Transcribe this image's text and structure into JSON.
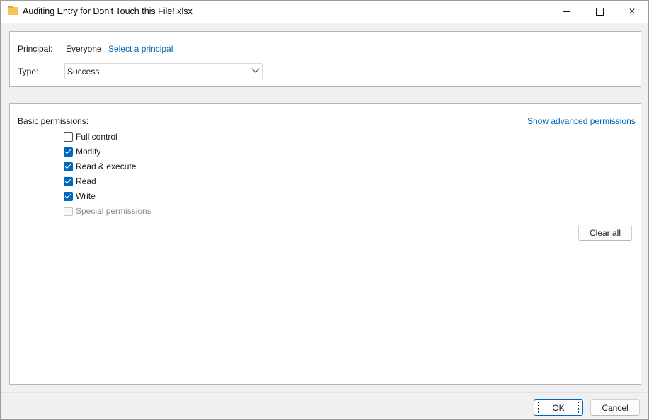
{
  "window": {
    "title": "Auditing Entry for Don't Touch this File!.xlsx",
    "title_icon": "folder-icon",
    "controls": {
      "minimize": "minimize-icon",
      "maximize": "maximize-icon",
      "close": "×"
    }
  },
  "principal": {
    "label": "Principal:",
    "value": "Everyone",
    "link": "Select a principal"
  },
  "type": {
    "label": "Type:",
    "selected": "Success"
  },
  "permissions": {
    "label": "Basic permissions:",
    "advanced_link": "Show advanced permissions",
    "items": [
      {
        "label": "Full control",
        "checked": false,
        "disabled": false
      },
      {
        "label": "Modify",
        "checked": true,
        "disabled": false
      },
      {
        "label": "Read & execute",
        "checked": true,
        "disabled": false
      },
      {
        "label": "Read",
        "checked": true,
        "disabled": false
      },
      {
        "label": "Write",
        "checked": true,
        "disabled": false
      },
      {
        "label": "Special permissions",
        "checked": false,
        "disabled": true
      }
    ],
    "clear_all": "Clear all"
  },
  "footer": {
    "ok": "OK",
    "cancel": "Cancel"
  },
  "colors": {
    "accent": "#0067c0",
    "link": "#0063b1",
    "folder": "#f2c45a"
  }
}
